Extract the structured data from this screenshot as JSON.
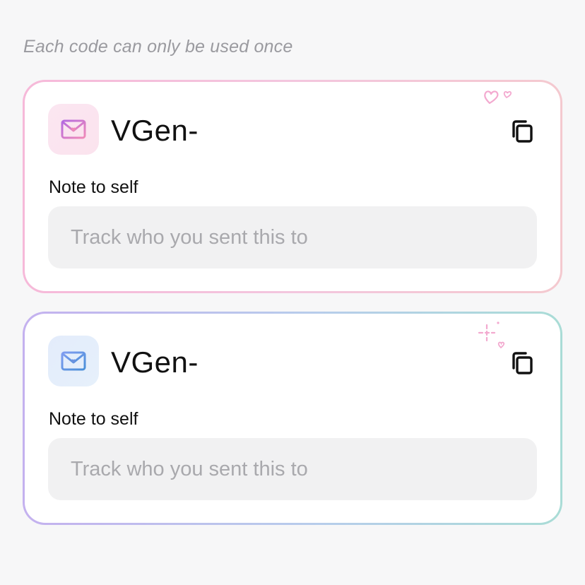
{
  "header": {
    "hint": "Each code can only be used once"
  },
  "cards": [
    {
      "code": "VGen-",
      "note_label": "Note to self",
      "note_placeholder": "Track who you sent this to",
      "note_value": "",
      "theme": "pink",
      "icon": "envelope-heart-icon",
      "decoration": "hearts-doodle-icon"
    },
    {
      "code": "VGen-",
      "note_label": "Note to self",
      "note_placeholder": "Track who you sent this to",
      "note_value": "",
      "theme": "blue",
      "icon": "envelope-heart-icon",
      "decoration": "sparkle-heart-doodle-icon"
    }
  ],
  "colors": {
    "pink_border": "#f6b9d9",
    "blue_border_start": "#c4b1ef",
    "blue_border_end": "#a9dcd6",
    "hint_text": "#9a9a9f",
    "input_bg": "#f1f1f2"
  }
}
